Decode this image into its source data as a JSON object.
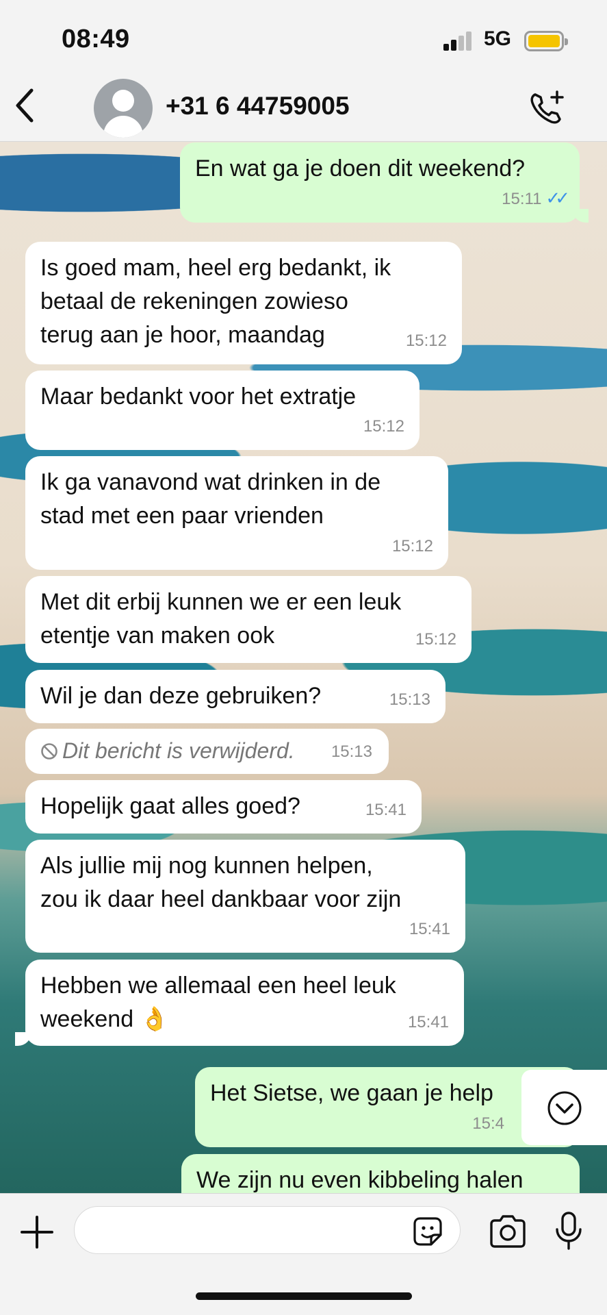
{
  "status_bar": {
    "time": "08:49",
    "network": "5G"
  },
  "header": {
    "contact_name": "+31 6 44759005"
  },
  "messages": [
    {
      "dir": "out",
      "text": "En wat ga je doen dit weekend?",
      "time": "15:11",
      "read_ticks": "✓✓"
    },
    {
      "dir": "in",
      "lines": [
        "Is goed mam, heel erg bedankt, ik",
        "betaal de rekeningen zowieso",
        "terug aan je hoor, maandag"
      ],
      "time": "15:12"
    },
    {
      "dir": "in",
      "text": "Maar bedankt voor het extratje",
      "time": "15:12"
    },
    {
      "dir": "in",
      "lines": [
        "Ik ga vanavond wat drinken in de",
        "stad met een paar vrienden"
      ],
      "time": "15:12"
    },
    {
      "dir": "in",
      "lines": [
        "Met dit erbij kunnen we er een leuk",
        "etentje van maken ook"
      ],
      "time": "15:12"
    },
    {
      "dir": "in",
      "text": "Wil je dan deze gebruiken?",
      "time": "15:13"
    },
    {
      "dir": "in",
      "text": "Dit bericht is verwijderd.",
      "time": "15:13",
      "deleted": true
    },
    {
      "dir": "in",
      "text": "Hopelijk gaat alles goed?",
      "time": "15:41"
    },
    {
      "dir": "in",
      "lines": [
        "Als jullie mij nog kunnen helpen,",
        "zou ik daar heel dankbaar voor zijn"
      ],
      "time": "15:41"
    },
    {
      "dir": "in",
      "lines": [
        "Hebben we allemaal een heel leuk",
        "weekend 👌"
      ],
      "time": "15:41"
    },
    {
      "dir": "out",
      "text": "Het Sietse, we gaan je help",
      "time": "15:4"
    },
    {
      "dir": "out",
      "text": "We zijn nu even kibbeling halen"
    }
  ],
  "composer": {
    "placeholder": ""
  },
  "colors": {
    "incoming": "#ffffff",
    "outgoing": "#d8fdd2",
    "read_ticks": "#3f93e8",
    "battery": "#f5c400"
  }
}
